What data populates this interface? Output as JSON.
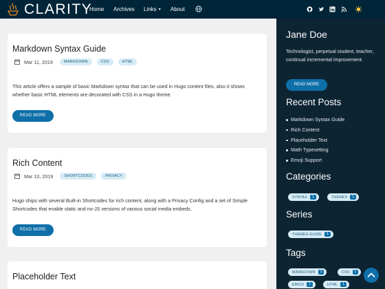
{
  "header": {
    "brand": "CLARITY",
    "nav": [
      {
        "label": "Home"
      },
      {
        "label": "Archives"
      },
      {
        "label": "Links",
        "dropdown": true
      },
      {
        "label": "About"
      }
    ],
    "icons": [
      "globe-icon",
      "github-icon",
      "twitter-icon",
      "linkedin-icon",
      "rss-icon",
      "theme-toggle-icon"
    ],
    "colors": {
      "bar": "#002538",
      "accent": "#0e6fa9"
    }
  },
  "posts": [
    {
      "title": "Markdown Syntax Guide",
      "date": "Mar 11, 2019",
      "tags": [
        "MARKDOWN",
        "CSS",
        "HTML"
      ],
      "excerpt": "This article offers a sample of basic Markdown syntax that can be used in Hugo content files, also it shows whether basic HTML elements are decorated with CSS in a Hugo theme.",
      "button": "READ MORE"
    },
    {
      "title": "Rich Content",
      "date": "Mar 10, 2019",
      "tags": [
        "SHORTCODES",
        "PRIVACY"
      ],
      "excerpt": "Hugo ships with several Built-in Shortcodes for rich content, along with a Privacy Config and a set of Simple Shortcodes that enable static and no-JS versions of various social media embeds.",
      "button": "READ MORE"
    },
    {
      "title": "Placeholder Text"
    }
  ],
  "sidebar": {
    "author": "Jane Doe",
    "bio": "Technologist, perpetual student, teacher, continual incremental improvement.",
    "button": "READ MORE",
    "recent_heading": "Recent Posts",
    "recent": [
      "Markdown Syntax Guide",
      "Rich Content",
      "Placeholder Text",
      "Math Typesetting",
      "Emoji Support"
    ],
    "categories_heading": "Categories",
    "categories": [
      {
        "label": "SYNTAX",
        "count": "1"
      },
      {
        "label": "THEMES",
        "count": "1"
      }
    ],
    "series_heading": "Series",
    "series": [
      {
        "label": "THEMES-GUIDE",
        "count": "1"
      }
    ],
    "tags_heading": "Tags",
    "tags": [
      {
        "label": "MARKDOWN",
        "count": "2"
      },
      {
        "label": "CSS",
        "count": "1"
      },
      {
        "label": "EMOJI",
        "count": "1"
      },
      {
        "label": "HTML",
        "count": "1"
      }
    ]
  }
}
